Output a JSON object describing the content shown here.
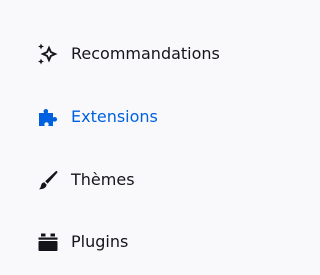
{
  "sidebar": {
    "items": [
      {
        "label": "Recommandations",
        "icon": "sparkles-icon",
        "selected": false
      },
      {
        "label": "Extensions",
        "icon": "puzzle-piece-icon",
        "selected": true
      },
      {
        "label": "Thèmes",
        "icon": "brush-icon",
        "selected": false
      },
      {
        "label": "Plugins",
        "icon": "plugin-icon",
        "selected": false
      }
    ]
  },
  "colors": {
    "background": "#f9f9fb",
    "text": "#15141a",
    "accent": "#0061e0"
  }
}
